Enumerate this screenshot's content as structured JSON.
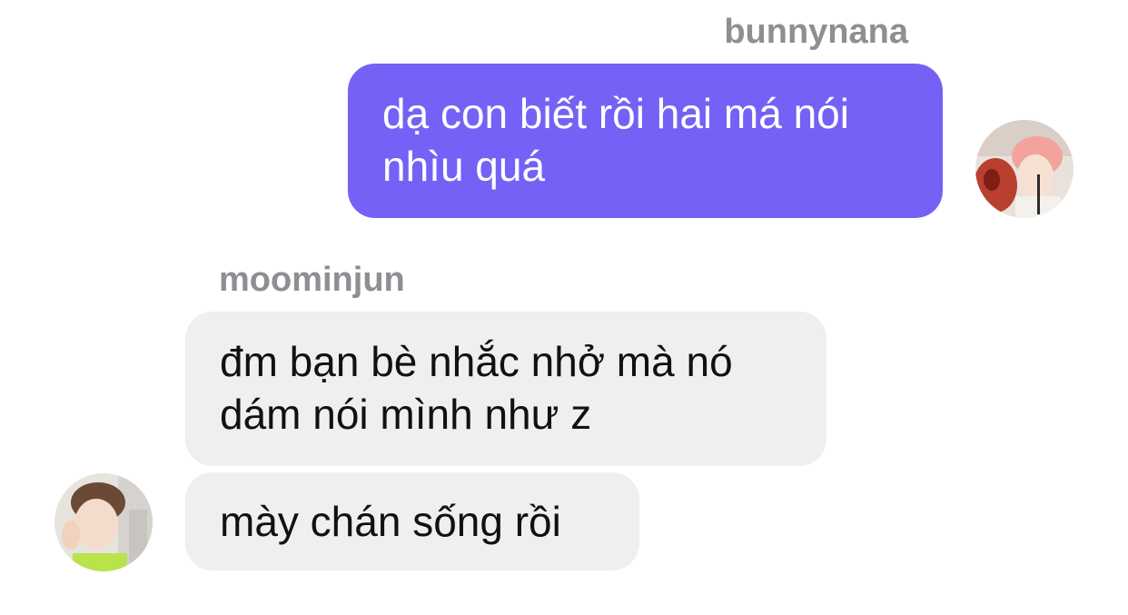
{
  "messages": [
    {
      "sender": "bunnynana",
      "direction": "outgoing",
      "texts": [
        "dạ con biết rồi hai má nói nhìu quá"
      ]
    },
    {
      "sender": "moominjun",
      "direction": "incoming",
      "texts": [
        "đm bạn bè nhắc nhở mà nó dám nói mình như z",
        "mày chán sống rồi"
      ]
    }
  ],
  "colors": {
    "outgoing_bubble": "#7561f6",
    "incoming_bubble": "#efefef",
    "sender_name": "#8e8e93"
  },
  "icons": {
    "outgoing_avatar": "avatar-photo",
    "incoming_avatar": "avatar-photo"
  }
}
